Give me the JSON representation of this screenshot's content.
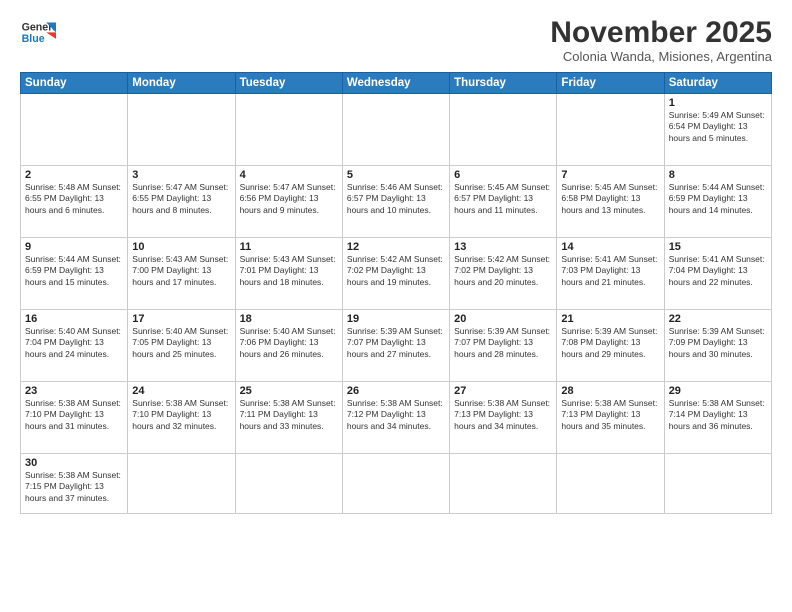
{
  "header": {
    "logo_general": "General",
    "logo_blue": "Blue",
    "month_title": "November 2025",
    "subtitle": "Colonia Wanda, Misiones, Argentina"
  },
  "weekdays": [
    "Sunday",
    "Monday",
    "Tuesday",
    "Wednesday",
    "Thursday",
    "Friday",
    "Saturday"
  ],
  "weeks": [
    [
      {
        "day": "",
        "info": ""
      },
      {
        "day": "",
        "info": ""
      },
      {
        "day": "",
        "info": ""
      },
      {
        "day": "",
        "info": ""
      },
      {
        "day": "",
        "info": ""
      },
      {
        "day": "",
        "info": ""
      },
      {
        "day": "1",
        "info": "Sunrise: 5:49 AM\nSunset: 6:54 PM\nDaylight: 13 hours and 5 minutes."
      }
    ],
    [
      {
        "day": "2",
        "info": "Sunrise: 5:48 AM\nSunset: 6:55 PM\nDaylight: 13 hours and 6 minutes."
      },
      {
        "day": "3",
        "info": "Sunrise: 5:47 AM\nSunset: 6:55 PM\nDaylight: 13 hours and 8 minutes."
      },
      {
        "day": "4",
        "info": "Sunrise: 5:47 AM\nSunset: 6:56 PM\nDaylight: 13 hours and 9 minutes."
      },
      {
        "day": "5",
        "info": "Sunrise: 5:46 AM\nSunset: 6:57 PM\nDaylight: 13 hours and 10 minutes."
      },
      {
        "day": "6",
        "info": "Sunrise: 5:45 AM\nSunset: 6:57 PM\nDaylight: 13 hours and 11 minutes."
      },
      {
        "day": "7",
        "info": "Sunrise: 5:45 AM\nSunset: 6:58 PM\nDaylight: 13 hours and 13 minutes."
      },
      {
        "day": "8",
        "info": "Sunrise: 5:44 AM\nSunset: 6:59 PM\nDaylight: 13 hours and 14 minutes."
      }
    ],
    [
      {
        "day": "9",
        "info": "Sunrise: 5:44 AM\nSunset: 6:59 PM\nDaylight: 13 hours and 15 minutes."
      },
      {
        "day": "10",
        "info": "Sunrise: 5:43 AM\nSunset: 7:00 PM\nDaylight: 13 hours and 17 minutes."
      },
      {
        "day": "11",
        "info": "Sunrise: 5:43 AM\nSunset: 7:01 PM\nDaylight: 13 hours and 18 minutes."
      },
      {
        "day": "12",
        "info": "Sunrise: 5:42 AM\nSunset: 7:02 PM\nDaylight: 13 hours and 19 minutes."
      },
      {
        "day": "13",
        "info": "Sunrise: 5:42 AM\nSunset: 7:02 PM\nDaylight: 13 hours and 20 minutes."
      },
      {
        "day": "14",
        "info": "Sunrise: 5:41 AM\nSunset: 7:03 PM\nDaylight: 13 hours and 21 minutes."
      },
      {
        "day": "15",
        "info": "Sunrise: 5:41 AM\nSunset: 7:04 PM\nDaylight: 13 hours and 22 minutes."
      }
    ],
    [
      {
        "day": "16",
        "info": "Sunrise: 5:40 AM\nSunset: 7:04 PM\nDaylight: 13 hours and 24 minutes."
      },
      {
        "day": "17",
        "info": "Sunrise: 5:40 AM\nSunset: 7:05 PM\nDaylight: 13 hours and 25 minutes."
      },
      {
        "day": "18",
        "info": "Sunrise: 5:40 AM\nSunset: 7:06 PM\nDaylight: 13 hours and 26 minutes."
      },
      {
        "day": "19",
        "info": "Sunrise: 5:39 AM\nSunset: 7:07 PM\nDaylight: 13 hours and 27 minutes."
      },
      {
        "day": "20",
        "info": "Sunrise: 5:39 AM\nSunset: 7:07 PM\nDaylight: 13 hours and 28 minutes."
      },
      {
        "day": "21",
        "info": "Sunrise: 5:39 AM\nSunset: 7:08 PM\nDaylight: 13 hours and 29 minutes."
      },
      {
        "day": "22",
        "info": "Sunrise: 5:39 AM\nSunset: 7:09 PM\nDaylight: 13 hours and 30 minutes."
      }
    ],
    [
      {
        "day": "23",
        "info": "Sunrise: 5:38 AM\nSunset: 7:10 PM\nDaylight: 13 hours and 31 minutes."
      },
      {
        "day": "24",
        "info": "Sunrise: 5:38 AM\nSunset: 7:10 PM\nDaylight: 13 hours and 32 minutes."
      },
      {
        "day": "25",
        "info": "Sunrise: 5:38 AM\nSunset: 7:11 PM\nDaylight: 13 hours and 33 minutes."
      },
      {
        "day": "26",
        "info": "Sunrise: 5:38 AM\nSunset: 7:12 PM\nDaylight: 13 hours and 34 minutes."
      },
      {
        "day": "27",
        "info": "Sunrise: 5:38 AM\nSunset: 7:13 PM\nDaylight: 13 hours and 34 minutes."
      },
      {
        "day": "28",
        "info": "Sunrise: 5:38 AM\nSunset: 7:13 PM\nDaylight: 13 hours and 35 minutes."
      },
      {
        "day": "29",
        "info": "Sunrise: 5:38 AM\nSunset: 7:14 PM\nDaylight: 13 hours and 36 minutes."
      }
    ],
    [
      {
        "day": "30",
        "info": "Sunrise: 5:38 AM\nSunset: 7:15 PM\nDaylight: 13 hours and 37 minutes."
      },
      {
        "day": "",
        "info": ""
      },
      {
        "day": "",
        "info": ""
      },
      {
        "day": "",
        "info": ""
      },
      {
        "day": "",
        "info": ""
      },
      {
        "day": "",
        "info": ""
      },
      {
        "day": "",
        "info": ""
      }
    ]
  ]
}
